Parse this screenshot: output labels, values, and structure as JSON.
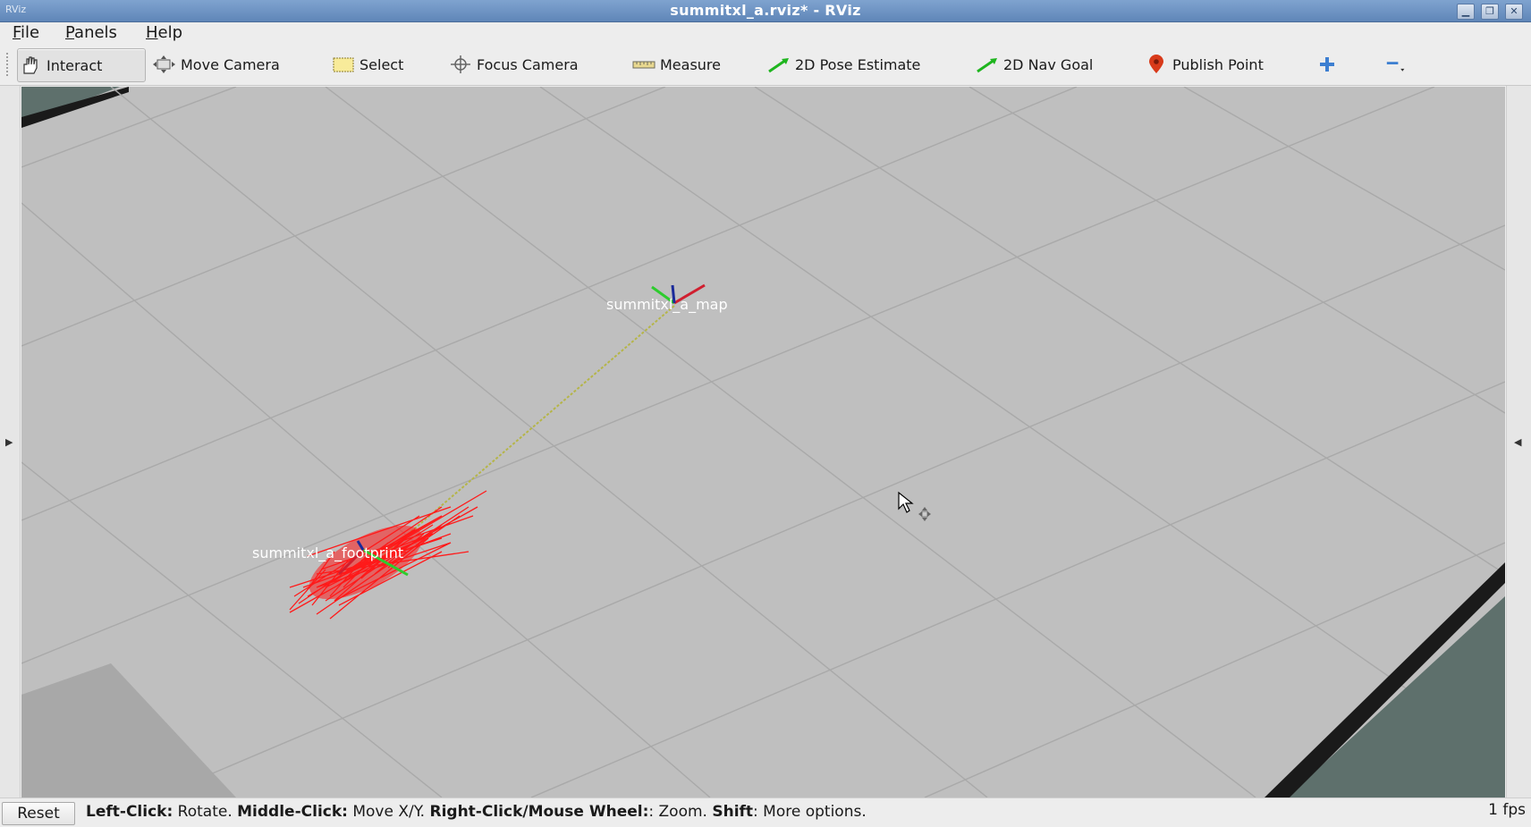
{
  "window": {
    "app_icon_text": "RViz",
    "title": "summitxl_a.rviz* - RViz",
    "controls": [
      "minimize",
      "maximize",
      "close"
    ]
  },
  "menu": {
    "items": [
      "File",
      "Panels",
      "Help"
    ]
  },
  "toolbar": {
    "tools": [
      {
        "label": "Interact",
        "icon": "hand-icon",
        "active": true
      },
      {
        "label": "Move Camera",
        "icon": "move-camera-icon",
        "active": false
      },
      {
        "label": "Select",
        "icon": "select-rect-icon",
        "active": false
      },
      {
        "label": "Focus Camera",
        "icon": "focus-crosshair-icon",
        "active": false
      },
      {
        "label": "Measure",
        "icon": "ruler-icon",
        "active": false
      },
      {
        "label": "2D Pose Estimate",
        "icon": "green-arrow-icon",
        "active": false
      },
      {
        "label": "2D Nav Goal",
        "icon": "green-arrow-icon",
        "active": false
      },
      {
        "label": "Publish Point",
        "icon": "map-pin-icon",
        "active": false
      }
    ],
    "add_tool_icon": "plus-icon",
    "remove_tool_icon": "minus-icon"
  },
  "viewport": {
    "frames": [
      {
        "label": "summitxl_a_map"
      },
      {
        "label": "summitxl_a_footprint"
      }
    ],
    "colors": {
      "floor": "#bfbfbf",
      "grid": "#a8a8a8",
      "particles": "#ff1a1a",
      "wall": "#1a1a1a",
      "wall_top": "#5e706c"
    }
  },
  "status": {
    "reset_label": "Reset",
    "hint_parts": [
      {
        "bold": "Left-Click:",
        "text": " Rotate. "
      },
      {
        "bold": "Middle-Click:",
        "text": " Move X/Y. "
      },
      {
        "bold": "Right-Click/Mouse Wheel:",
        "text": ": Zoom. "
      },
      {
        "bold": "Shift",
        "text": ": More options."
      }
    ],
    "fps": "1 fps"
  }
}
